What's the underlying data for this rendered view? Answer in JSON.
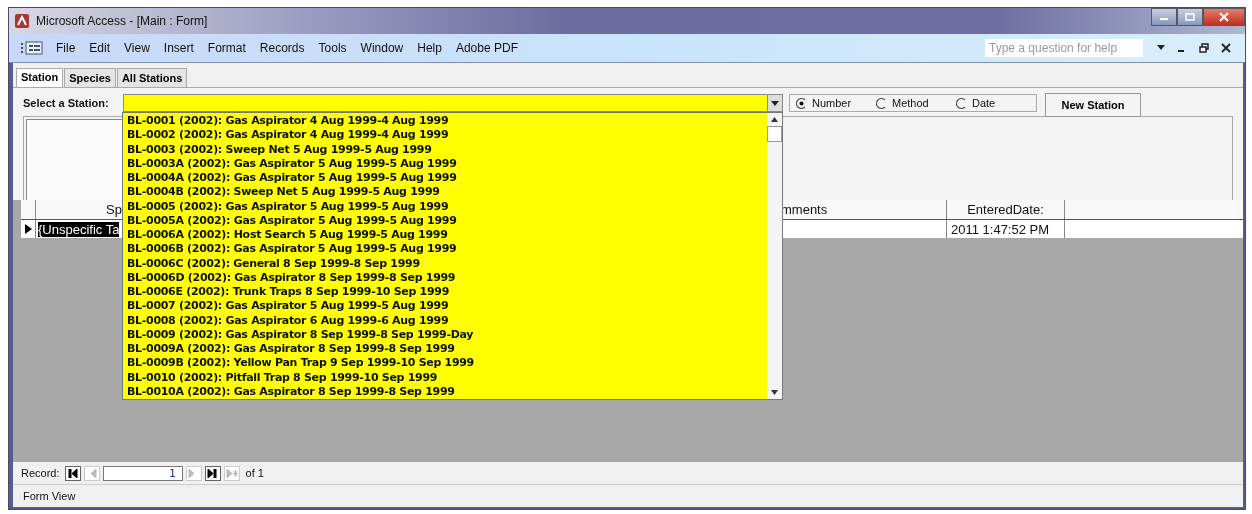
{
  "window": {
    "title": "Microsoft Access - [Main : Form]"
  },
  "menu": [
    "File",
    "Edit",
    "View",
    "Insert",
    "Format",
    "Records",
    "Tools",
    "Window",
    "Help",
    "Adobe PDF"
  ],
  "help_box": {
    "placeholder": "Type a question for help"
  },
  "tabs": [
    {
      "label": "Station",
      "selected": true
    },
    {
      "label": "Species",
      "selected": false
    },
    {
      "label": "All Stations",
      "selected": false
    }
  ],
  "station_select": {
    "label": "Select a Station:"
  },
  "sort_options": [
    {
      "label": "Number",
      "selected": true
    },
    {
      "label": "Method",
      "selected": false
    },
    {
      "label": "Date",
      "selected": false
    }
  ],
  "new_station_button": "New Station",
  "dropdown": {
    "items": [
      "BL-0001 (2002): Gas Aspirator 4 Aug 1999-4 Aug 1999",
      "BL-0002 (2002): Gas Aspirator 4 Aug 1999-4 Aug 1999",
      "BL-0003 (2002): Sweep Net 5 Aug 1999-5 Aug 1999",
      "BL-0003A (2002): Gas Aspirator 5 Aug 1999-5 Aug 1999",
      "BL-0004A (2002): Gas Aspirator 5 Aug 1999-5 Aug 1999",
      "BL-0004B (2002): Sweep Net 5 Aug 1999-5 Aug 1999",
      "BL-0005 (2002): Gas Aspirator 5 Aug 1999-5 Aug 1999",
      "BL-0005A (2002): Gas Aspirator 5 Aug 1999-5 Aug 1999",
      "BL-0006A (2002): Host Search 5 Aug 1999-5 Aug 1999",
      "BL-0006B (2002): Gas Aspirator 5 Aug 1999-5 Aug 1999",
      "BL-0006C (2002): General  8 Sep 1999-8 Sep 1999",
      "BL-0006D (2002): Gas Aspirator 8 Sep 1999-8 Sep 1999",
      "BL-0006E (2002): Trunk Traps 8 Sep 1999-10 Sep 1999",
      "BL-0007 (2002): Gas Aspirator 5 Aug 1999-5 Aug 1999",
      "BL-0008 (2002): Gas Aspirator 6 Aug 1999-6 Aug 1999",
      "BL-0009 (2002): Gas Aspirator 8 Sep 1999-8 Sep 1999-Day",
      "BL-0009A (2002): Gas Aspirator 8 Sep 1999-8 Sep 1999",
      "BL-0009B (2002): Yellow Pan Trap 9 Sep 1999-10 Sep 1999",
      "BL-0010 (2002): Pitfall Trap 8 Sep 1999-10 Sep 1999",
      "BL-0010A (2002): Gas Aspirator 8 Sep 1999-8 Sep 1999"
    ]
  },
  "datasheet": {
    "columns": [
      "Sp",
      "mments",
      "EnteredDate:"
    ],
    "rows": [
      {
        "cells": [
          "{Unspecific Ta",
          "",
          "2011 1:47:52 PM"
        ],
        "selected": true
      }
    ]
  },
  "record_nav": {
    "label": "Record:",
    "current": "1",
    "total": "of 1",
    "buttons": [
      {
        "kind": "first",
        "disabled": false
      },
      {
        "kind": "prev",
        "disabled": true
      },
      {
        "kind": "next",
        "disabled": true
      },
      {
        "kind": "last",
        "disabled": false
      },
      {
        "kind": "new",
        "disabled": true
      }
    ]
  },
  "status_bar": "Form View"
}
